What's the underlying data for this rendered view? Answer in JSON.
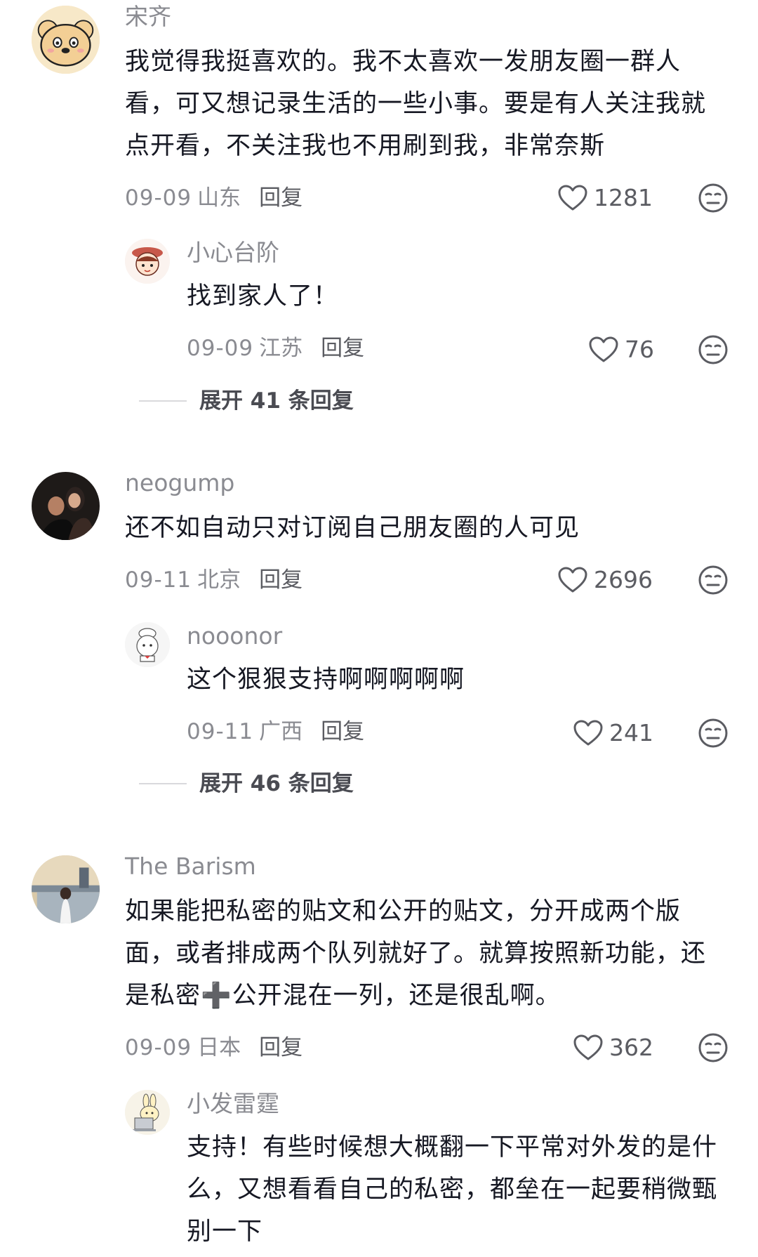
{
  "comments": [
    {
      "user": "宋齐",
      "text": "我觉得我挺喜欢的。我不太喜欢一发朋友圈一群人看，可又想记录生活的一些小事。要是有人关注我就点开看，不关注我也不用刷到我，非常奈斯",
      "date": "09-09",
      "location": "山东",
      "reply_label": "回复",
      "likes": "1281",
      "reply": {
        "user": "小心台阶",
        "text": "找到家人了！",
        "date": "09-09",
        "location": "江苏",
        "reply_label": "回复",
        "likes": "76"
      },
      "expand": "展开 41 条回复"
    },
    {
      "user": "neogump",
      "text": "还不如自动只对订阅自己朋友圈的人可见",
      "date": "09-11",
      "location": "北京",
      "reply_label": "回复",
      "likes": "2696",
      "reply": {
        "user": "nooonor",
        "text": "这个狠狠支持啊啊啊啊啊",
        "date": "09-11",
        "location": "广西",
        "reply_label": "回复",
        "likes": "241"
      },
      "expand": "展开 46 条回复"
    },
    {
      "user": "The Barism",
      "text": "如果能把私密的贴文和公开的贴文，分开成两个版面，或者排成两个队列就好了。就算按照新功能，还是私密➕公开混在一列，还是很乱啊。",
      "date": "09-09",
      "location": "日本",
      "reply_label": "回复",
      "likes": "362",
      "reply": {
        "user": "小发雷霆",
        "text": "支持！有些时候想大概翻一下平常对外发的是什么，又想看看自己的私密，都垒在一起要稍微甄别一下"
      }
    }
  ],
  "icons": {
    "like": "heart-outline-icon",
    "dislike": "unamused-face-icon"
  },
  "colors": {
    "text": "#161823",
    "meta": "#8a8b91",
    "icon": "#5b5c62"
  }
}
